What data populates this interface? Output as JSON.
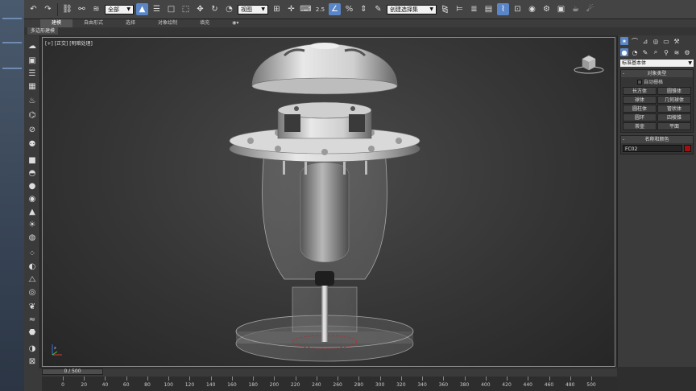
{
  "toolbar": {
    "selection_filter": "全部",
    "reference_coord": "视图",
    "named_selection": "创建选择集",
    "snap_label": "2.5",
    "angle_label": "%"
  },
  "ribbon": {
    "tabs": [
      "建模",
      "自由形式",
      "选择",
      "对象绘制",
      "填充"
    ],
    "active_tab": "建模",
    "sub_label": "多边形建模"
  },
  "viewport": {
    "label": "[+] [正交] [明暗处理]"
  },
  "command_panel": {
    "category_dropdown": "标准基本体",
    "object_type_header": "对象类型",
    "autogrid_label": "自动栅格",
    "object_buttons": [
      "长方体",
      "圆锥体",
      "球体",
      "几何球体",
      "圆柱体",
      "管状体",
      "圆环",
      "四棱锥",
      "茶壶",
      "平面"
    ],
    "name_color_header": "名称和颜色",
    "object_name": "FC02",
    "object_color": "#a01010"
  },
  "timeline": {
    "frame_display": "0 / 500",
    "ruler_labels": [
      "0",
      "20",
      "40",
      "60",
      "80",
      "100",
      "120",
      "140",
      "160",
      "180",
      "200",
      "220",
      "240",
      "260",
      "280",
      "300",
      "320",
      "340",
      "360",
      "380",
      "400",
      "420",
      "440",
      "460",
      "480",
      "500"
    ]
  },
  "colors": {
    "accent": "#5a86c7",
    "panel_bg": "#3b3b3b"
  }
}
